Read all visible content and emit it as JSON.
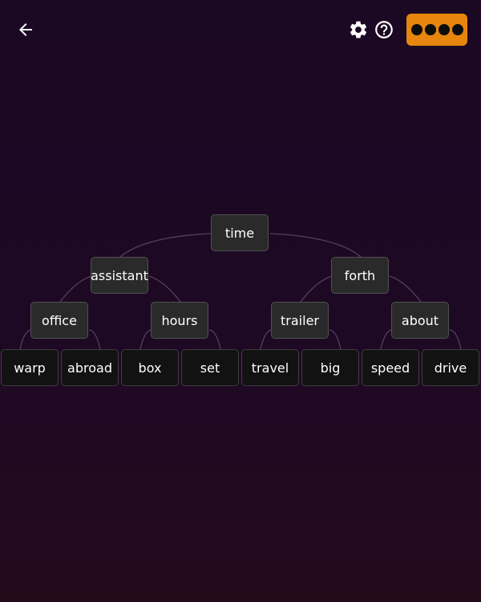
{
  "header": {
    "back_icon": "arrow-left-icon",
    "settings_icon": "gear-icon",
    "help_icon": "help-circle-icon",
    "hint_button": {
      "dots": 4,
      "color": "#e8850d"
    }
  },
  "tree": {
    "root": "time",
    "level1": [
      "assistant",
      "forth"
    ],
    "level2": [
      "office",
      "hours",
      "trailer",
      "about"
    ],
    "leaves": [
      "warp",
      "abroad",
      "box",
      "set",
      "travel",
      "big",
      "speed",
      "drive"
    ]
  },
  "colors": {
    "background_top": "#1b0823",
    "background_bottom": "#250a1c",
    "node_fill": "#2a2a2a",
    "leaf_fill": "#121212",
    "accent": "#e8850d"
  }
}
